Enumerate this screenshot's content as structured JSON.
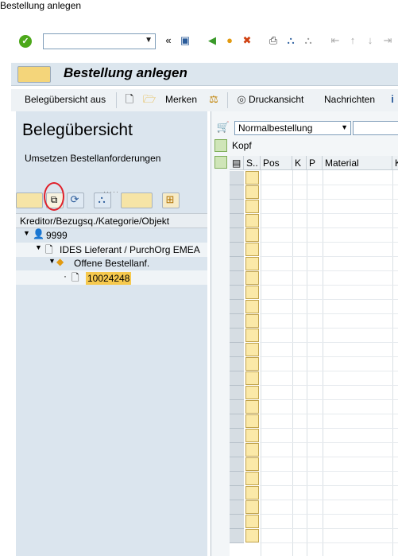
{
  "window": {
    "title": "Bestellung anlegen"
  },
  "app": {
    "title": "Bestellung anlegen",
    "toolbar": {
      "overview": "Belegübersicht aus",
      "remember": "Merken",
      "print_preview": "Druckansicht",
      "messages": "Nachrichten"
    }
  },
  "left_pane": {
    "title": "Belegübersicht",
    "subtitle": "Umsetzen Bestellanforderungen",
    "column_header": "Kreditor/Bezugsq./Kategorie/Objekt",
    "tree": [
      {
        "label": "9999"
      },
      {
        "label": "IDES Lieferant / PurchOrg EMEA"
      },
      {
        "label": "Offene Bestellanf."
      },
      {
        "label": "10024248"
      }
    ]
  },
  "right_pane": {
    "order_type": "Normalbestellung",
    "header_label": "Kopf",
    "columns": [
      "S..",
      "Pos",
      "K",
      "P",
      "Material",
      "K"
    ]
  },
  "colors": {
    "accent_yellow": "#f6c94e",
    "highlight_circle": "#e0202a",
    "panel_bg": "#dbe5ee"
  }
}
